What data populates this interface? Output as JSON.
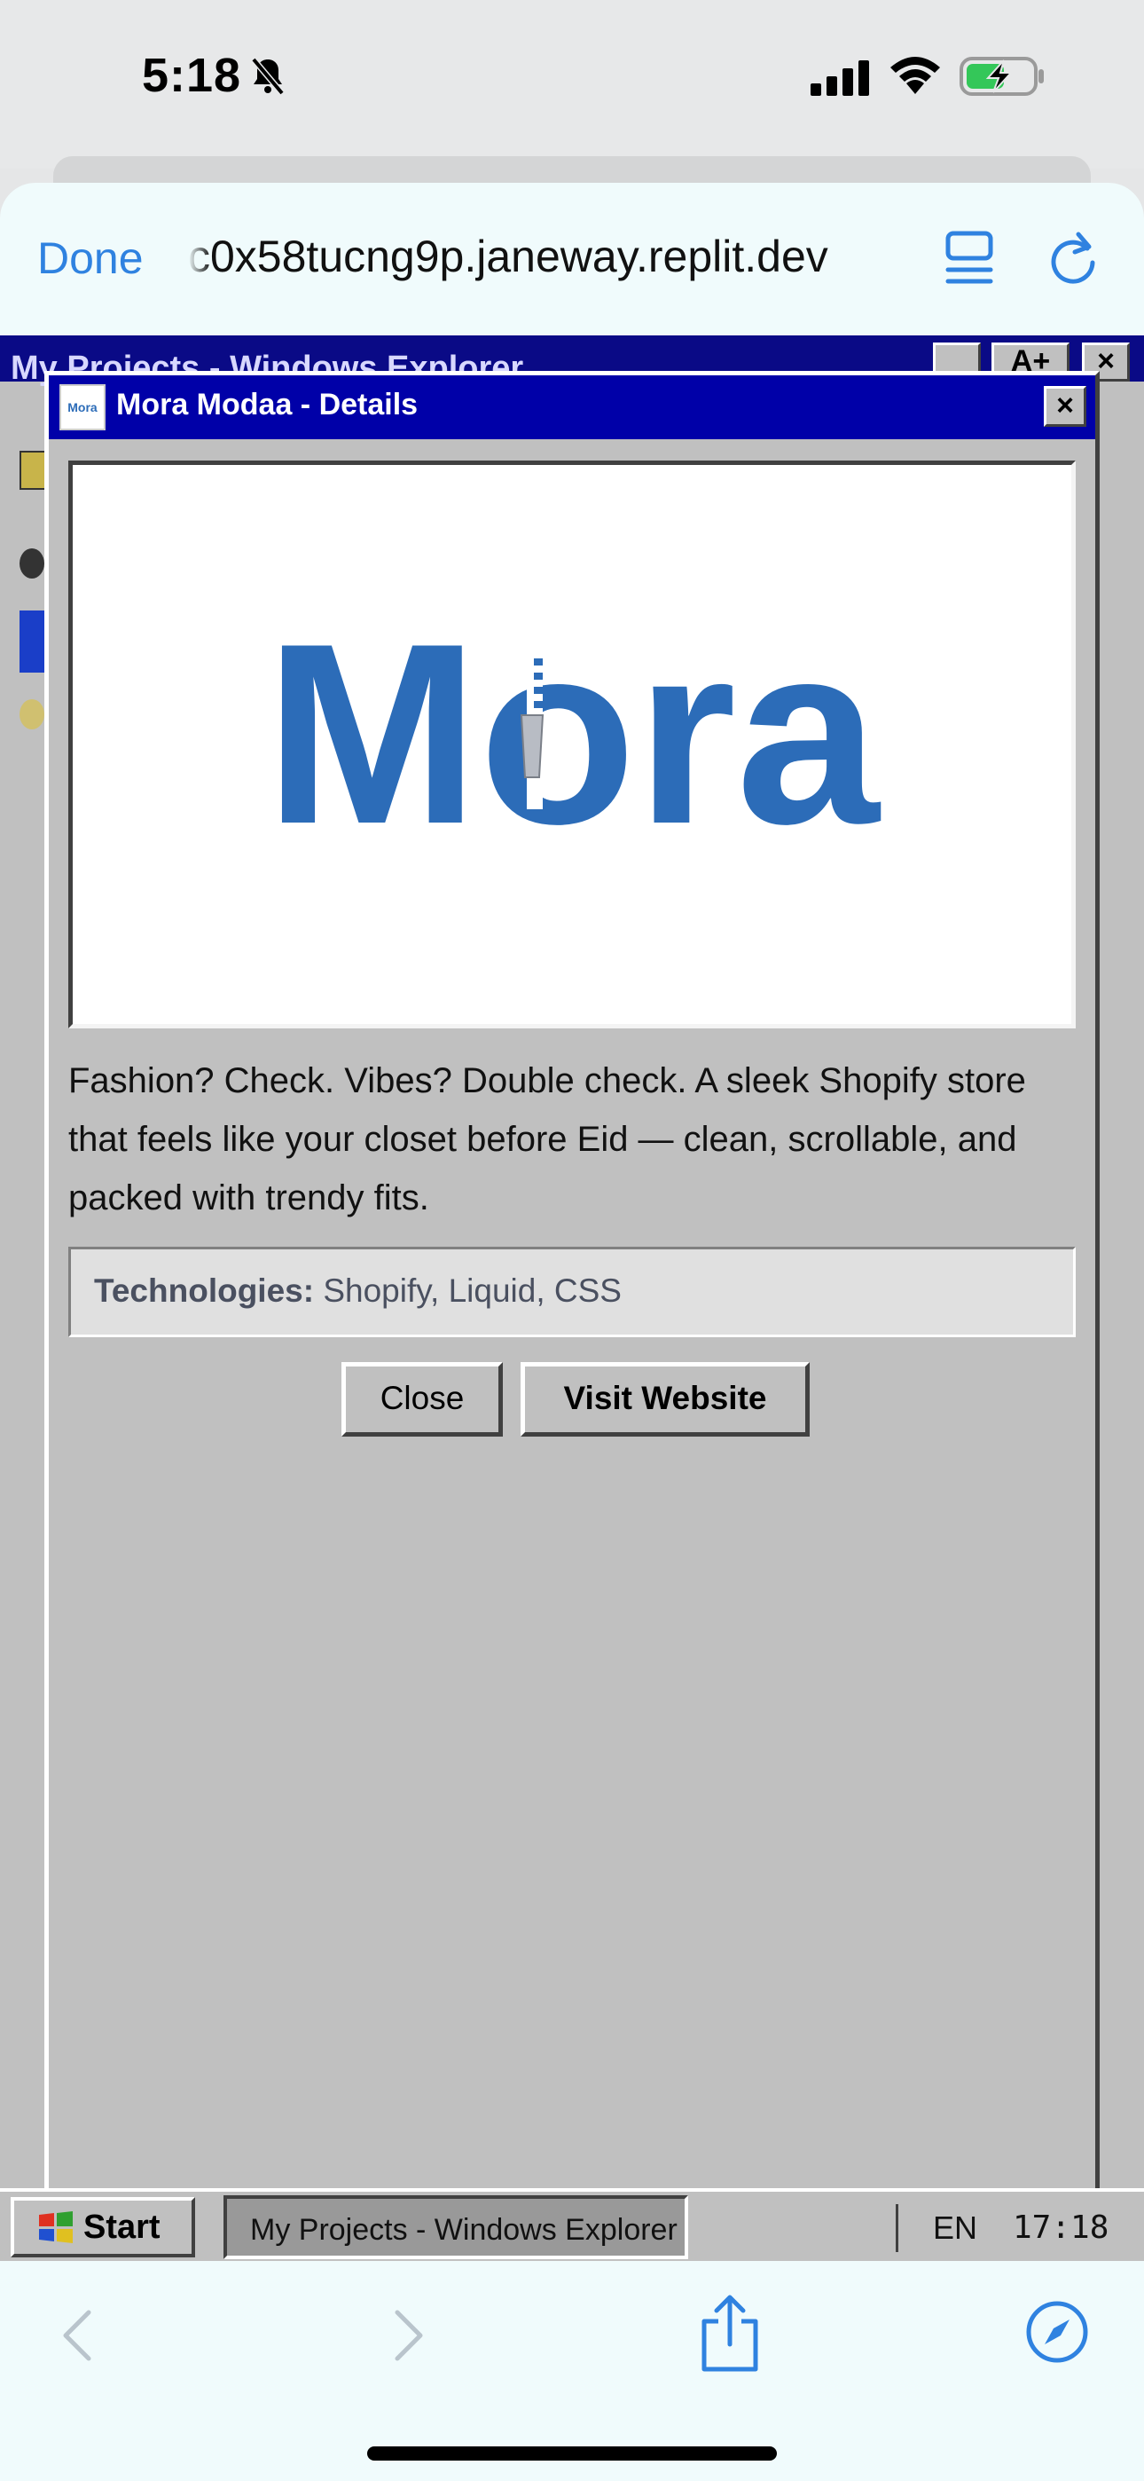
{
  "status_bar": {
    "time": "5:18"
  },
  "browser": {
    "done_label": "Done",
    "url": "c0x58tucng9p.janeway.replit.dev"
  },
  "background_window": {
    "title": "My Projects - Windows Explorer",
    "controls": [
      "_",
      "A+",
      "×"
    ]
  },
  "dialog": {
    "icon_text": "Mora",
    "title": "Mora Modaa - Details",
    "close_glyph": "×",
    "logo_text": "Mora",
    "description": "Fashion? Check. Vibes? Double check. A sleek Shopify store that feels like your closet before Eid — clean, scrollable, and packed with trendy fits.",
    "technologies_label": "Technologies:",
    "technologies_value": "Shopify, Liquid, CSS",
    "close_button": "Close",
    "visit_button": "Visit Website"
  },
  "taskbar": {
    "start_label": "Start",
    "task_item": "My Projects - Windows Explorer",
    "language": "EN",
    "clock": "17:18"
  },
  "colors": {
    "accent_blue": "#2f82e0",
    "title_bar": "#0000a8",
    "logo_blue": "#2c6cb8",
    "window_gray": "#c0c0c0"
  }
}
